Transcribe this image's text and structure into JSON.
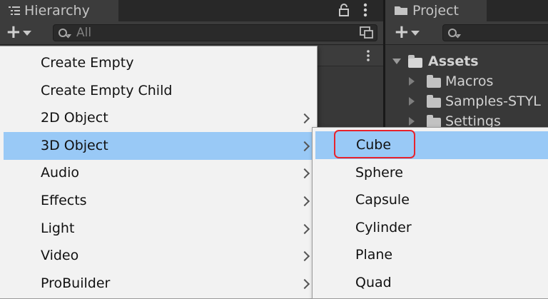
{
  "hierarchy": {
    "tab_title": "Hierarchy",
    "search_placeholder": "All"
  },
  "project": {
    "tab_title": "Project",
    "tree": [
      {
        "label": "Assets",
        "expanded": true
      },
      {
        "label": "Macros"
      },
      {
        "label": "Samples-STYL"
      },
      {
        "label": "Settings"
      }
    ]
  },
  "context_menu": {
    "items": [
      {
        "label": "Create Empty",
        "submenu": false
      },
      {
        "label": "Create Empty Child",
        "submenu": false
      },
      {
        "label": "2D Object",
        "submenu": true
      },
      {
        "label": "3D Object",
        "submenu": true,
        "selected": true
      },
      {
        "label": "Audio",
        "submenu": true
      },
      {
        "label": "Effects",
        "submenu": true
      },
      {
        "label": "Light",
        "submenu": true
      },
      {
        "label": "Video",
        "submenu": true
      },
      {
        "label": "ProBuilder",
        "submenu": true
      }
    ]
  },
  "submenu_3d": {
    "items": [
      {
        "label": "Cube",
        "selected": true
      },
      {
        "label": "Sphere"
      },
      {
        "label": "Capsule"
      },
      {
        "label": "Cylinder"
      },
      {
        "label": "Plane"
      },
      {
        "label": "Quad"
      }
    ]
  },
  "colors": {
    "selection": "#99c9f6",
    "highlight_border": "#e8232c",
    "menu_bg": "#f2f2f2",
    "editor_bg": "#383838"
  }
}
